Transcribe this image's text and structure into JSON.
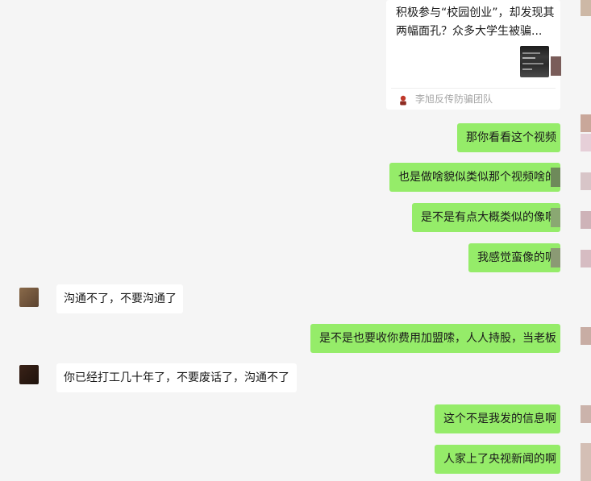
{
  "shared_card": {
    "title": "积极参与“校园创业”，却发现其两幅面孔？众多大学生被骗...",
    "source": "李旭反传防骗团队"
  },
  "messages": [
    {
      "from": "me",
      "text": "那你看看这个视频"
    },
    {
      "from": "me",
      "text": "也是做啥貌似类似那个视频啥的"
    },
    {
      "from": "me",
      "text": "是不是有点大概类似的像啊"
    },
    {
      "from": "me",
      "text": "我感觉蛮像的呢"
    },
    {
      "from": "other",
      "text": "沟通不了，不要沟通了"
    },
    {
      "from": "me",
      "text": "是不是也要收你费用加盟嗦，人人持股，当老板"
    },
    {
      "from": "other",
      "text": "你已经打工几十年了，不要废话了，沟通不了"
    },
    {
      "from": "me",
      "text": "这个不是我发的信息啊"
    },
    {
      "from": "me",
      "text": "人家上了央视新闻的啊"
    }
  ],
  "colors": {
    "background": "#f5f5f5",
    "my_bubble": "#95ec69",
    "their_bubble": "#ffffff"
  }
}
